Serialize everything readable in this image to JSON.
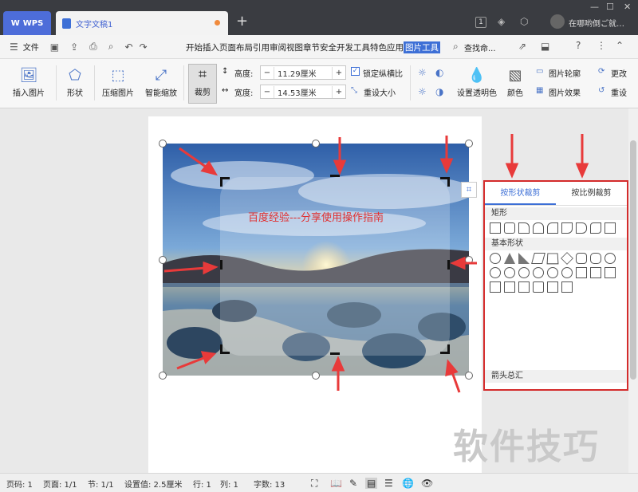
{
  "titlebar": {
    "app_tab": "WPS",
    "doc_tab": "文字文稿1",
    "new_tab": "+",
    "badge": "1",
    "user": "在哪哟倒ご就…"
  },
  "menubar": {
    "file": "文件",
    "menus": [
      "开始",
      "插入",
      "页面布局",
      "引用",
      "审阅",
      "视图",
      "章节",
      "安全",
      "开发工具",
      "特色应用",
      "图片工具"
    ],
    "active_menu": "图片工具",
    "search": "查找命..."
  },
  "ribbon": {
    "insert_picture": "插入图片",
    "shape": "形状",
    "compress": "压缩图片",
    "smart_zoom": "智能缩放",
    "crop": "裁剪",
    "height_label": "高度:",
    "height_value": "11.29厘米",
    "width_label": "宽度:",
    "width_value": "14.53厘米",
    "lock_ratio": "锁定纵横比",
    "reset_size": "重设大小",
    "transparent": "设置透明色",
    "color": "颜色",
    "outline": "图片轮廓",
    "effects": "图片效果",
    "change": "更改",
    "reset": "重设",
    "minus": "−",
    "plus": "+"
  },
  "canvas": {
    "overlay_text": "百度经验---分享使用操作指南"
  },
  "panel": {
    "tab_shape": "按形状裁剪",
    "tab_ratio": "按比例裁剪",
    "section_rect": "矩形",
    "section_basic": "基本形状",
    "section_arrows": "箭头总汇"
  },
  "status": {
    "page_num": "页码: 1",
    "pages": "页面: 1/1",
    "section": "节: 1/1",
    "setting": "设置值: 2.5厘米",
    "row": "行: 1",
    "col": "列: 1",
    "words": "字数: 13"
  },
  "watermark": "软件技巧",
  "colors": {
    "accent": "#3d6fd6",
    "highlight_border": "#d42b2b",
    "arrow": "#e83a3a",
    "titlebar": "#3a3c41"
  }
}
